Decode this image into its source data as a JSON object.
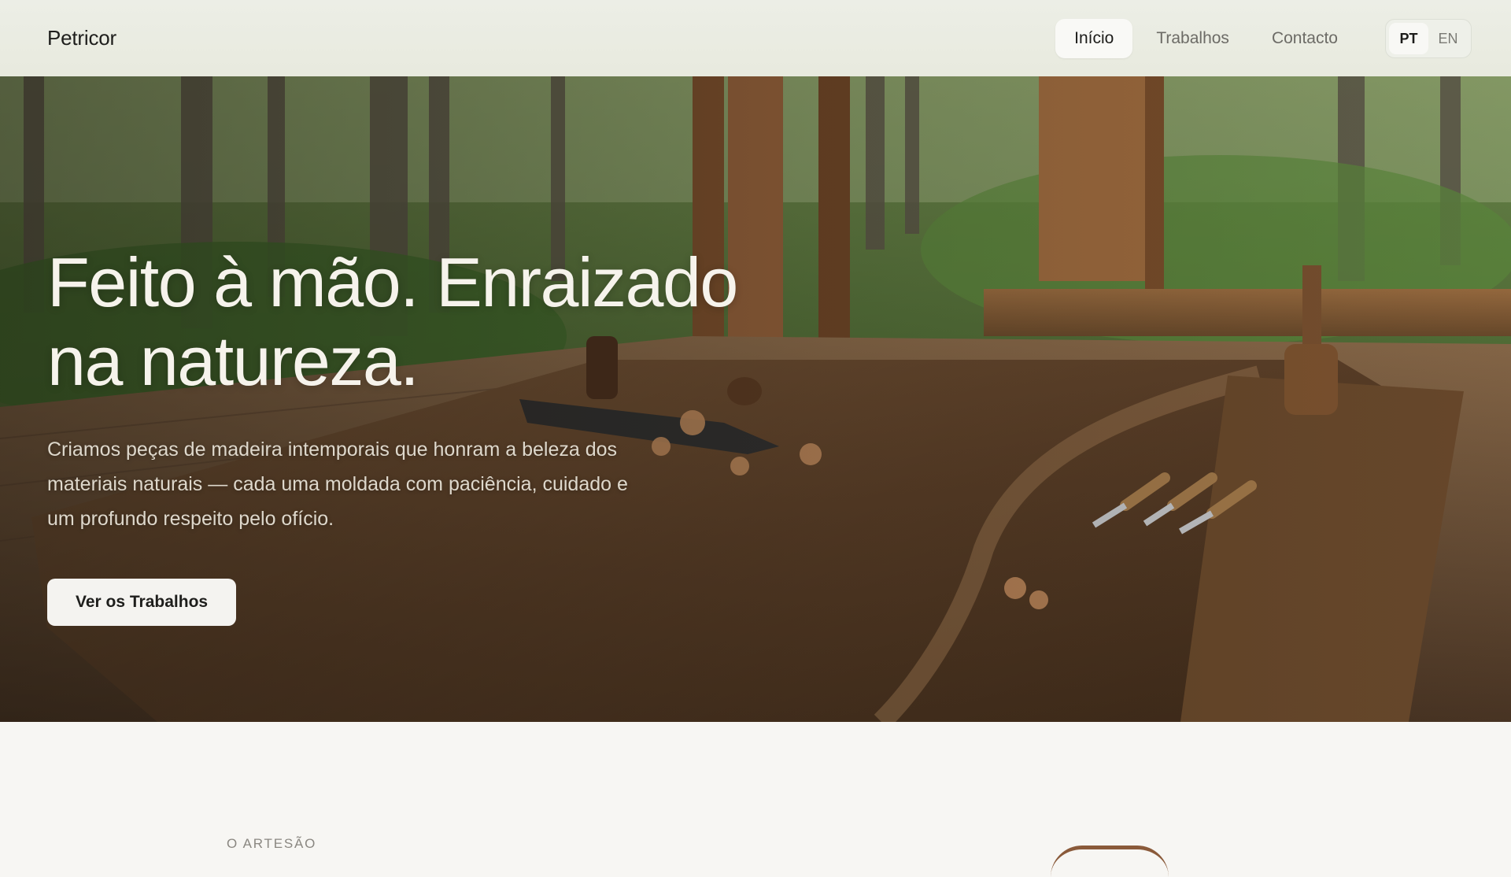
{
  "header": {
    "brand": "Petricor",
    "nav": [
      {
        "label": "Início",
        "active": true
      },
      {
        "label": "Trabalhos",
        "active": false
      },
      {
        "label": "Contacto",
        "active": false
      }
    ],
    "languages": [
      {
        "label": "PT",
        "active": true
      },
      {
        "label": "EN",
        "active": false
      }
    ]
  },
  "hero": {
    "title_line1": "Feito à mão. Enraizado",
    "title_line2": "na natureza.",
    "subtitle": "Criamos peças de madeira intemporais que honram a beleza dos materiais naturais — cada uma moldada com paciência, cuidado e um profundo respeito pelo ofício.",
    "cta_label": "Ver os Trabalhos"
  },
  "about": {
    "section_label": "O ARTESÃO"
  },
  "colors": {
    "header_bg": "#eceee6",
    "page_bg": "#f7f6f3",
    "cta_bg": "#f4f3f0",
    "wood": "#6b4a2e"
  }
}
